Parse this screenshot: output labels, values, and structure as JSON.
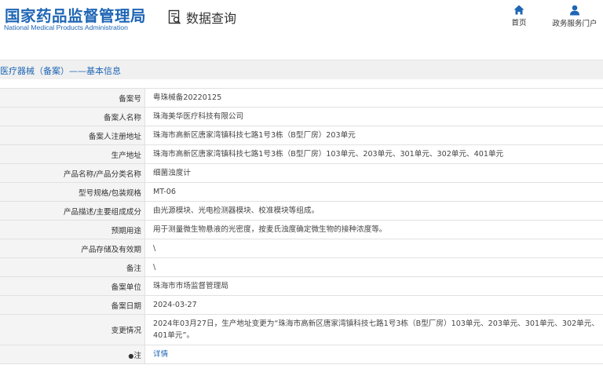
{
  "header": {
    "logo_cn": "国家药品监督管理局",
    "logo_en": "National Medical Products Administration",
    "query_label": "数据查询",
    "nav": [
      {
        "label": "首页",
        "icon": "home-icon"
      },
      {
        "label": "政务服务门户",
        "icon": "user-icon"
      }
    ]
  },
  "section": {
    "title": "医疗器械（备案）——基本信息"
  },
  "rows": [
    {
      "key": "备案号",
      "value": "粤珠械备20220125"
    },
    {
      "key": "备案人名称",
      "value": "珠海美华医疗科技有限公司"
    },
    {
      "key": "备案人注册地址",
      "value": "珠海市高新区唐家湾镇科技七路1号3栋（B型厂房）203单元"
    },
    {
      "key": "生产地址",
      "value": "珠海市高新区唐家湾镇科技七路1号3栋（B型厂房）103单元、203单元、301单元、302单元、401单元"
    },
    {
      "key": "产品名称/产品分类名称",
      "value": "细菌浊度计"
    },
    {
      "key": "型号规格/包装规格",
      "value": "MT-06"
    },
    {
      "key": "产品描述/主要组成成分",
      "value": "由光源模块、光电检测器模块、校准模块等组成。"
    },
    {
      "key": "预期用途",
      "value": "用于测量微生物悬液的光密度，按麦氏浊度确定微生物的接种浓度等。"
    },
    {
      "key": "产品存储及有效期",
      "value": "\\"
    },
    {
      "key": "备注",
      "value": "\\"
    },
    {
      "key": "备案单位",
      "value": "珠海市市场监督管理局"
    },
    {
      "key": "备案日期",
      "value": "2024-03-27"
    },
    {
      "key": "变更情况",
      "value": "2024年03月27日，生产地址变更为“珠海市高新区唐家湾镇科技七路1号3栋（B型厂房）103单元、203单元、301单元、302单元、401单元”。"
    },
    {
      "key": "注",
      "value": "详情"
    }
  ],
  "colors": {
    "brand": "#1f66b5",
    "key_bg": "#f4f4f4",
    "border": "#e1e1e1"
  }
}
